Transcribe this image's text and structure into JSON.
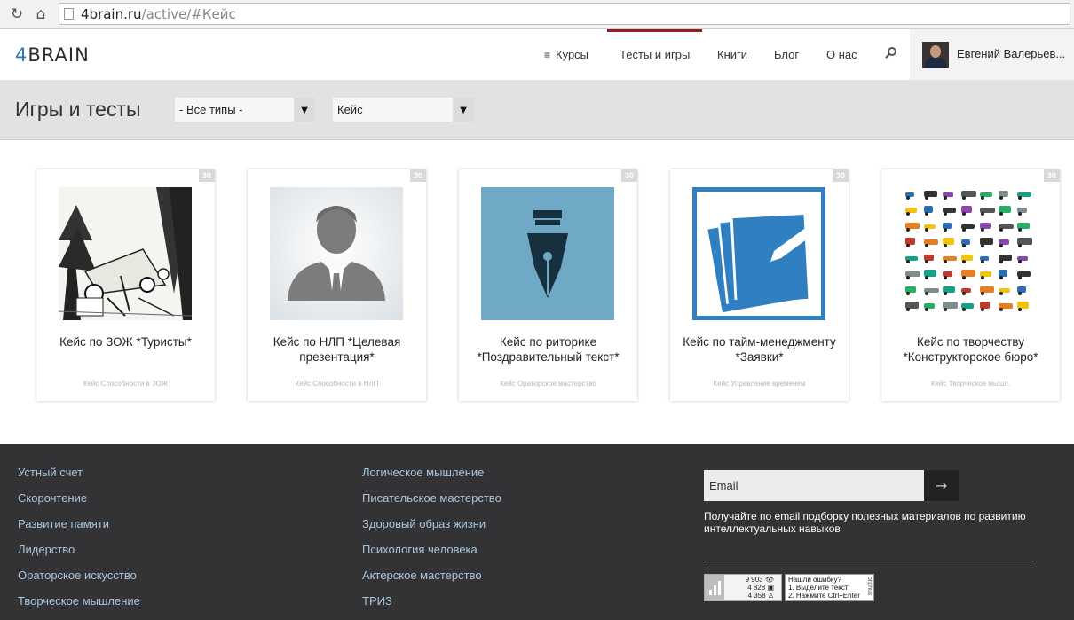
{
  "browser": {
    "url_domain": "4brain.ru",
    "url_path": "/active/#Кейс"
  },
  "header": {
    "logo_prefix": "4",
    "logo_rest": "BRAIN",
    "nav": [
      {
        "label": "Курсы"
      },
      {
        "label": "Тесты и игры",
        "active": true
      },
      {
        "label": "Книги"
      },
      {
        "label": "Блог"
      },
      {
        "label": "О нас"
      }
    ],
    "user_name": "Евгений Валерьев..."
  },
  "filters": {
    "title": "Игры и тесты",
    "type_select": "- Все типы -",
    "category_select": "Кейс"
  },
  "cards": [
    {
      "badge": "30",
      "title": "Кейс по ЗОЖ *Туристы*",
      "tags": "Кейс  Способности в ЗОЖ"
    },
    {
      "badge": "30",
      "title": "Кейс по НЛП *Целевая презентация*",
      "tags": "Кейс  Способности в НЛП"
    },
    {
      "badge": "30",
      "title": "Кейс по риторике *Поздравительный текст*",
      "tags": "Кейс  Ораторское мастерство"
    },
    {
      "badge": "30",
      "title": "Кейс по тайм-менеджменту *Заявки*",
      "tags": "Кейс  Управление временем"
    },
    {
      "badge": "30",
      "title": "Кейс по творчеству *Конструкторское бюро*",
      "tags": "Кейс  Творческое мышл."
    }
  ],
  "footer": {
    "col1": [
      "Устный счет",
      "Скорочтение",
      "Развитие памяти",
      "Лидерство",
      "Ораторское искусство",
      "Творческое мышление"
    ],
    "col2": [
      "Логическое мышление",
      "Писательское мастерство",
      "Здоровый образ жизни",
      "Психология человека",
      "Актерское мастерство",
      "ТРИЗ"
    ],
    "email_placeholder": "Email",
    "submit_arrow": "→",
    "subscribe_text": "Получайте по email подборку полезных материалов по развитию интеллектуальных навыков",
    "counter": [
      "9 903",
      "4 828",
      "4 358"
    ],
    "orphus": [
      "Нашли ошибку?",
      "1. Выделите текст",
      "2. Нажмите Ctrl+Enter"
    ],
    "orphus_brand": "orphus"
  },
  "colors": {
    "accent": "#8a1f24",
    "footer_bg": "#333336",
    "footer_link": "#a9c6dc",
    "filter_bg": "#e2e2e2"
  }
}
